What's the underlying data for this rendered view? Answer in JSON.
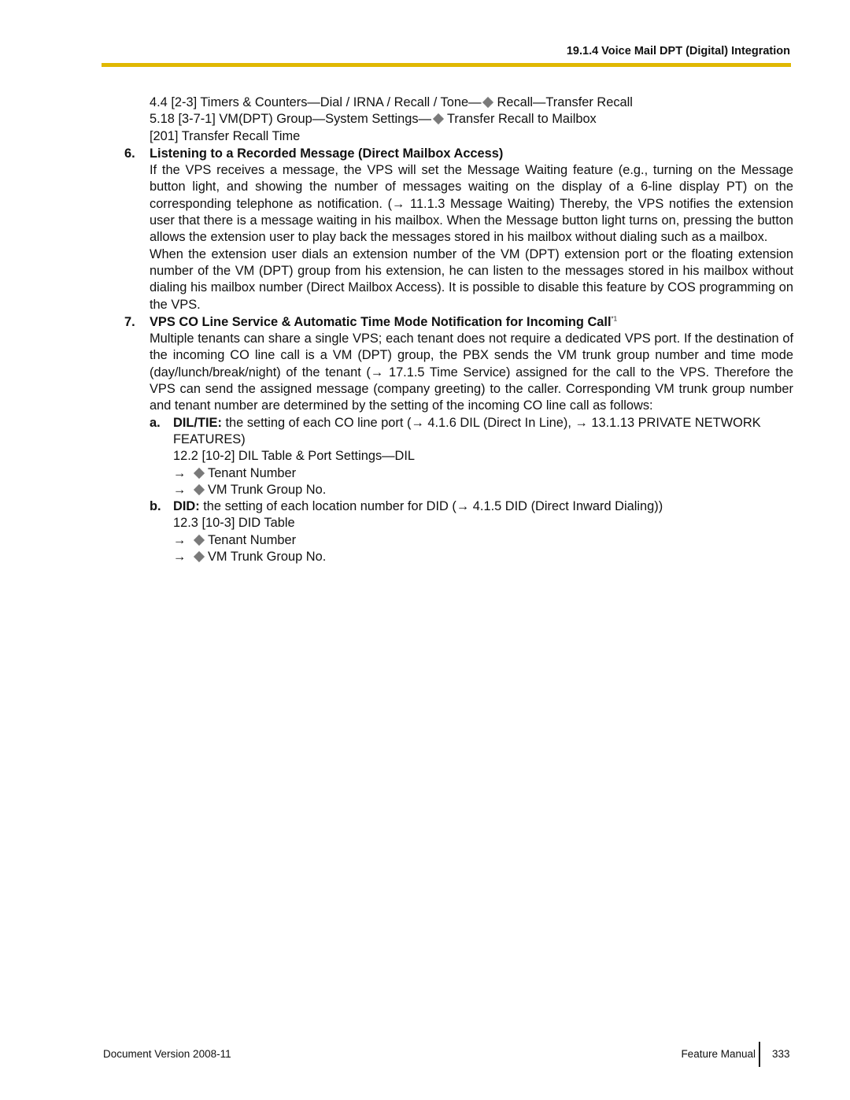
{
  "header": {
    "section_title": "19.1.4 Voice Mail DPT (Digital) Integration",
    "rule_color": "#e0b800"
  },
  "refs_top": [
    {
      "pre": "4.4  [2-3] Timers & Counters—Dial / IRNA / Recall / Tone—",
      "post": "Recall—Transfer Recall"
    },
    {
      "pre": "5.18  [3-7-1] VM(DPT) Group—System Settings—",
      "post": "Transfer Recall to Mailbox"
    },
    {
      "pre": "[201] Transfer Recall Time",
      "post": ""
    }
  ],
  "section6": {
    "number": "6.",
    "title": "Listening to a Recorded Message (Direct Mailbox Access)",
    "para1": "If the VPS receives a message, the VPS will set the Message Waiting feature (e.g., turning on the Message button light, and showing the number of messages waiting on the display of a 6-line display PT) on the corresponding telephone as notification. (→ 11.1.3  Message Waiting) Thereby, the VPS notifies the extension user that there is a message waiting in his mailbox. When the Message button light turns on, pressing the button allows the extension user to play back the messages stored in his mailbox without dialing such as a mailbox.",
    "para2": "When the extension user dials an extension number of the VM (DPT) extension port or the floating extension number of the VM (DPT) group from his extension, he can listen to the messages stored in his mailbox without dialing his mailbox number (Direct Mailbox Access). It is possible to disable this feature by COS programming on the VPS."
  },
  "section7": {
    "number": "7.",
    "title": "VPS CO Line Service & Automatic Time Mode Notification for Incoming Call",
    "footnote_mark": "*1",
    "para1": "Multiple tenants can share a single VPS; each tenant does not require a dedicated VPS port. If the destination of the incoming CO line call is a VM (DPT) group, the PBX sends the VM trunk group number and time mode (day/lunch/break/night) of the tenant (→ 17.1.5  Time Service) assigned for the call to the VPS. Therefore the VPS can send the assigned message (company greeting) to the caller. Corresponding VM trunk group number and tenant number are determined by the setting of the incoming CO line call as follows:",
    "items": [
      {
        "letter": "a.",
        "label": "DIL/TIE:",
        "text": " the setting of each CO line port (→ 4.1.6  DIL (Direct In Line), → 13.1.13  PRIVATE NETWORK FEATURES)",
        "ref": "12.2  [10-2] DIL Table & Port Settings—DIL",
        "arrow": "→",
        "subs": [
          "Tenant Number",
          "VM Trunk Group No."
        ]
      },
      {
        "letter": "b.",
        "label": "DID:",
        "text": " the setting of each location number for DID (→ 4.1.5  DID (Direct Inward Dialing))",
        "ref": "12.3  [10-3] DID Table",
        "arrow": "→",
        "subs": [
          "Tenant Number",
          "VM Trunk Group No."
        ]
      }
    ]
  },
  "footer": {
    "document_version_label": "Document Version  2008-11",
    "manual_name": "Feature Manual",
    "page_number": "333"
  }
}
